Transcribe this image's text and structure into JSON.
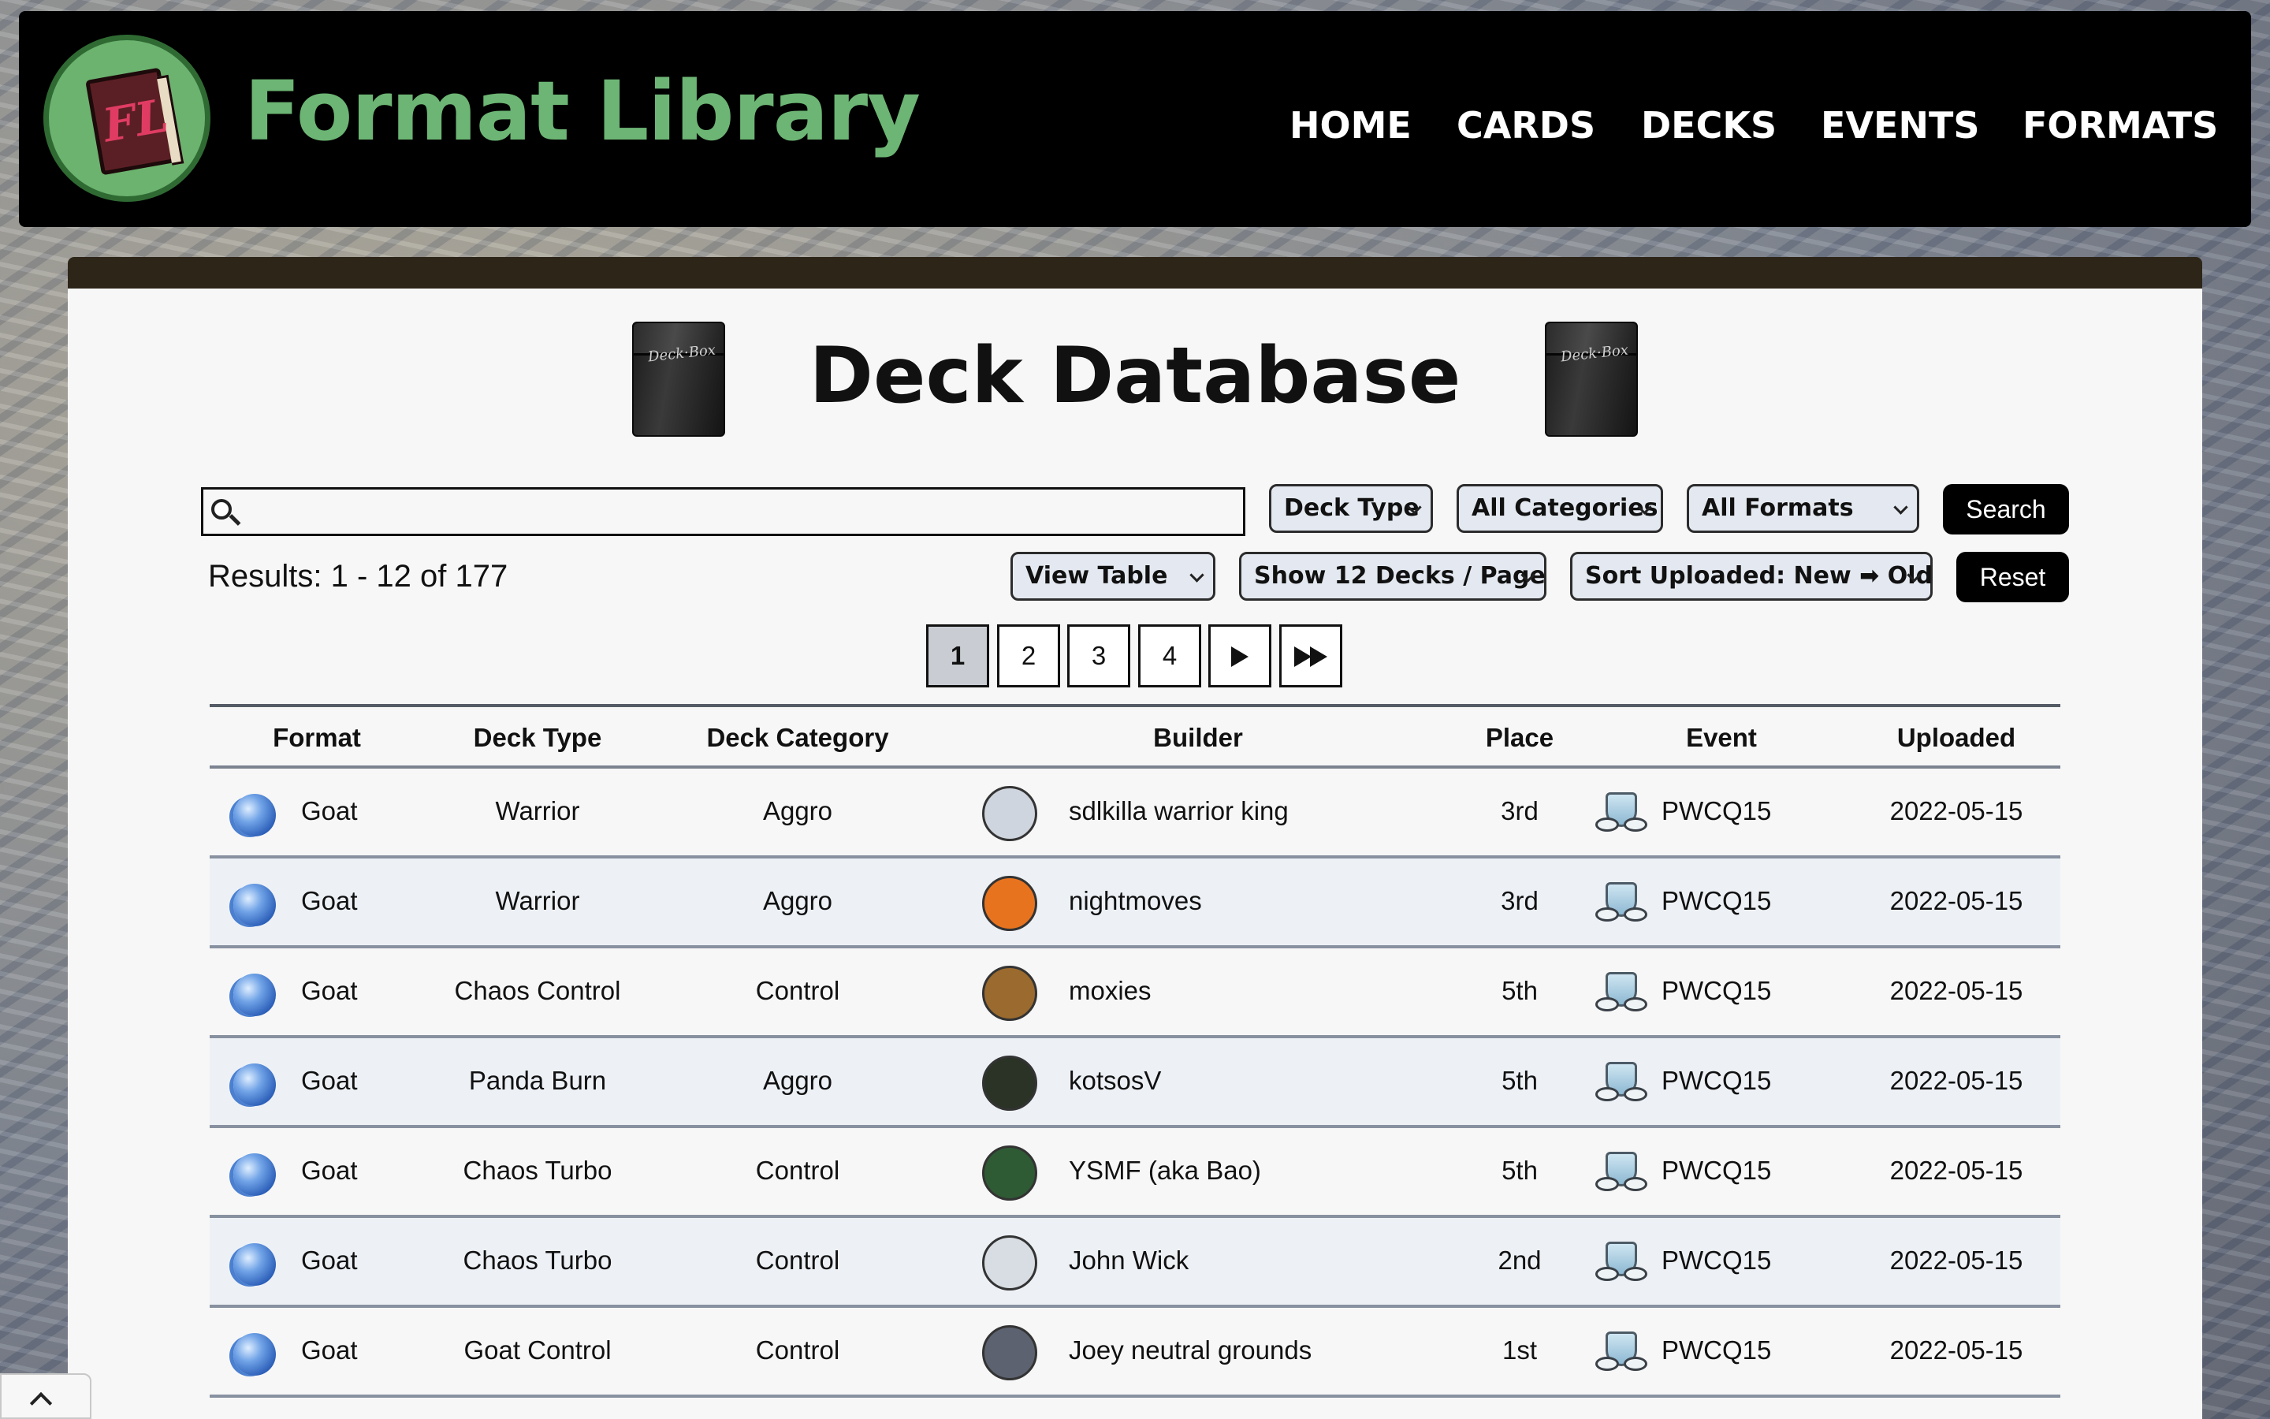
{
  "site": {
    "title": "Format Library",
    "logo_text": "FL"
  },
  "nav": [
    "HOME",
    "CARDS",
    "DECKS",
    "EVENTS",
    "FORMATS"
  ],
  "page_title": "Deck Database",
  "deck_box_label": "Deck·Box",
  "search": {
    "placeholder": "",
    "value": ""
  },
  "filters": {
    "deck_type": "Deck Type",
    "categories": "All Categories",
    "formats": "All Formats",
    "search_button": "Search",
    "view": "View Table",
    "per_page": "Show 12 Decks / Page",
    "sort": "Sort Uploaded: New ➡ Old",
    "reset_button": "Reset"
  },
  "results_text": "Results: 1 - 12 of 177",
  "pagination": [
    "1",
    "2",
    "3",
    "4"
  ],
  "table": {
    "headers": [
      "Format",
      "Deck Type",
      "Deck Category",
      "Builder",
      "Place",
      "Event",
      "Uploaded"
    ],
    "rows": [
      {
        "format": "Goat",
        "deck_type": "Warrior",
        "category": "Aggro",
        "builder": "sdlkilla warrior king",
        "place": "3rd",
        "event": "PWCQ15",
        "uploaded": "2022-05-15",
        "avatar_color": "#cfd5de"
      },
      {
        "format": "Goat",
        "deck_type": "Warrior",
        "category": "Aggro",
        "builder": "nightmoves",
        "place": "3rd",
        "event": "PWCQ15",
        "uploaded": "2022-05-15",
        "avatar_color": "#e8731f"
      },
      {
        "format": "Goat",
        "deck_type": "Chaos Control",
        "category": "Control",
        "builder": "moxies",
        "place": "5th",
        "event": "PWCQ15",
        "uploaded": "2022-05-15",
        "avatar_color": "#9a6a2e"
      },
      {
        "format": "Goat",
        "deck_type": "Panda Burn",
        "category": "Aggro",
        "builder": "kotsosV",
        "place": "5th",
        "event": "PWCQ15",
        "uploaded": "2022-05-15",
        "avatar_color": "#2a3326"
      },
      {
        "format": "Goat",
        "deck_type": "Chaos Turbo",
        "category": "Control",
        "builder": "YSMF (aka Bao)",
        "place": "5th",
        "event": "PWCQ15",
        "uploaded": "2022-05-15",
        "avatar_color": "#2e5a34"
      },
      {
        "format": "Goat",
        "deck_type": "Chaos Turbo",
        "category": "Control",
        "builder": "John Wick",
        "place": "2nd",
        "event": "PWCQ15",
        "uploaded": "2022-05-15",
        "avatar_color": "#d8dde4"
      },
      {
        "format": "Goat",
        "deck_type": "Goat Control",
        "category": "Control",
        "builder": "Joey neutral grounds",
        "place": "1st",
        "event": "PWCQ15",
        "uploaded": "2022-05-15",
        "avatar_color": "#5c6270"
      }
    ]
  }
}
